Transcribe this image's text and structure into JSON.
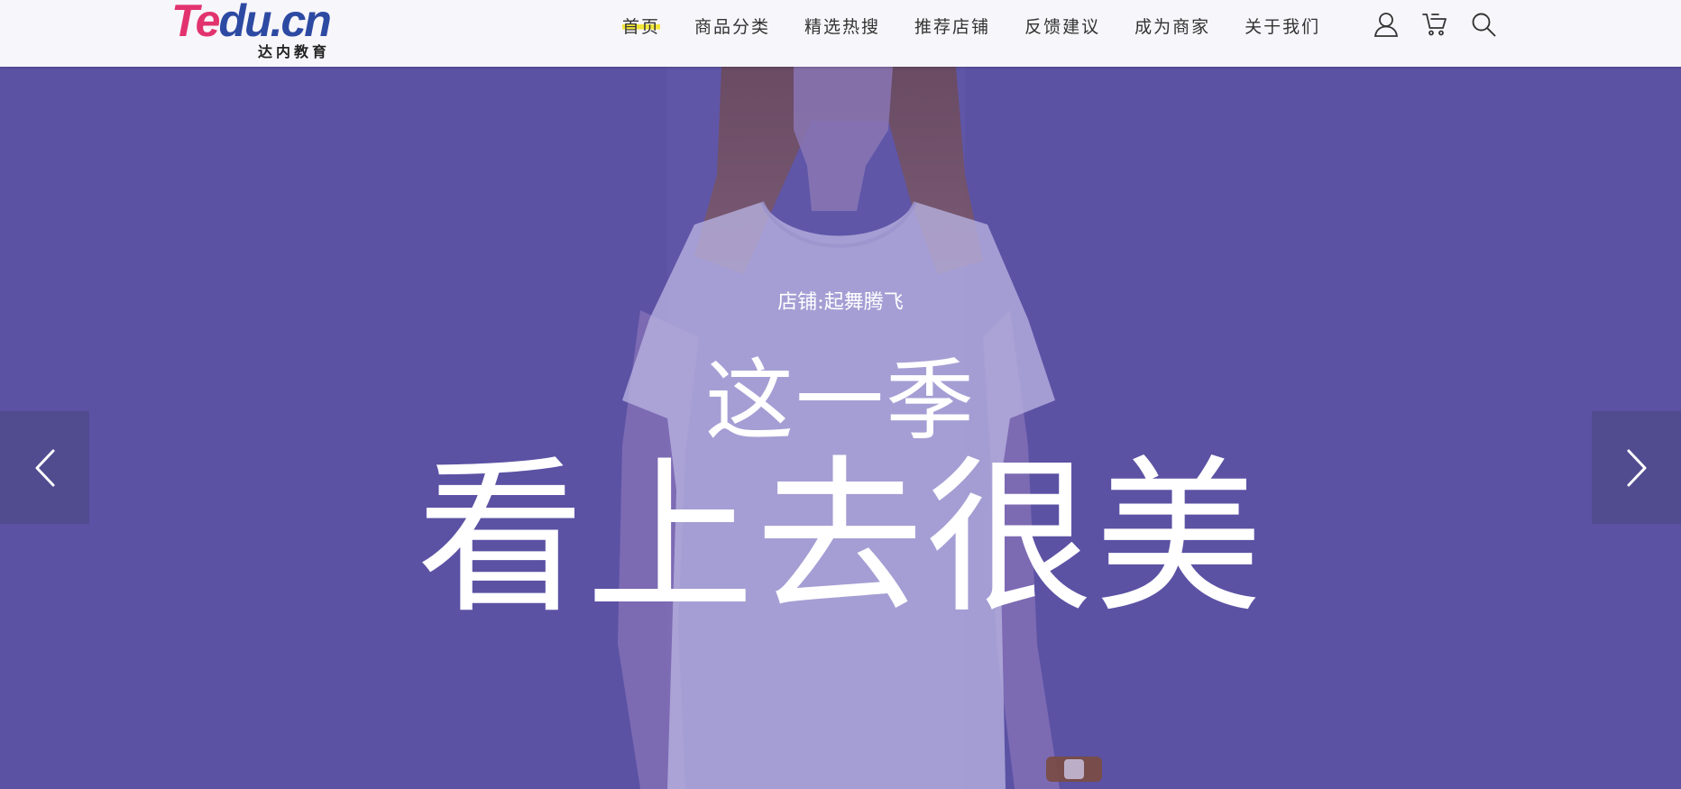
{
  "header": {
    "logo": {
      "brand_part1": "Te",
      "brand_part2": "du.cn",
      "subtitle": "达内教育"
    },
    "nav": [
      {
        "label": "首页",
        "active": true
      },
      {
        "label": "商品分类"
      },
      {
        "label": "精选热搜"
      },
      {
        "label": "推荐店铺"
      },
      {
        "label": "反馈建议"
      },
      {
        "label": "成为商家"
      },
      {
        "label": "关于我们"
      }
    ],
    "icons": [
      "user-icon",
      "cart-icon",
      "search-icon"
    ]
  },
  "hero": {
    "shop_label": "店铺:起舞腾飞",
    "headline_small": "这一季",
    "headline_large": "看上去很美",
    "prev_icon": "chevron-left-icon",
    "next_icon": "chevron-right-icon"
  },
  "colors": {
    "hero_overlay": "#5b52a4",
    "header_bg": "#f7f6fa",
    "nav_highlight": "#f2e73a",
    "logo_red": "#e2336e",
    "logo_blue": "#2d4aa3"
  }
}
